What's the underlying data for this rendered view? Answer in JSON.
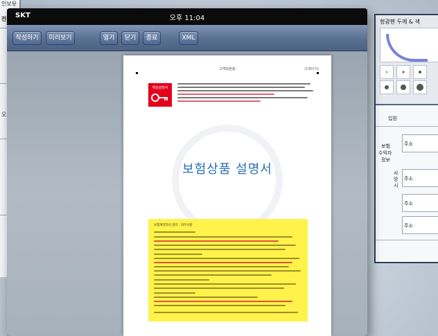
{
  "background_window": {
    "texts": [
      "인보유",
      "전",
      "오"
    ]
  },
  "status_bar": {
    "carrier": "SKT",
    "time": "오후 11:04"
  },
  "toolbar": {
    "buttons": [
      {
        "label": "작성하기"
      },
      {
        "label": "미리보기"
      },
      {
        "label": "열기"
      },
      {
        "label": "닫기"
      },
      {
        "label": "종료"
      },
      {
        "label": "XML"
      }
    ]
  },
  "document": {
    "header": "고객보관용",
    "label": "(1페이지)",
    "badge": "핵심설명서",
    "title": "보험상품 설명서",
    "yellow_box_heading": "보험계약자의 권리 · 의무사항"
  },
  "right_window": {
    "pen_title": "형광펜 두께 & 색",
    "form_labels": [
      "입원",
      "보험",
      "수익자",
      "정보",
      "사망시",
      "주소",
      "주소",
      "주소",
      "주소"
    ]
  },
  "colors": {
    "toolbar": "#5a7091",
    "title": "#2a6fb6",
    "highlight_box": "#fff24a",
    "badge": "#e4001b"
  }
}
